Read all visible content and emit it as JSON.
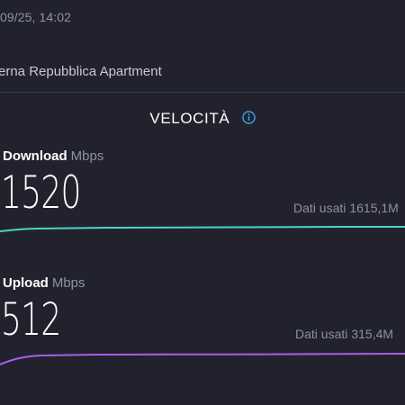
{
  "header": {
    "timestamp": "/09/25, 14:02",
    "server_name": "erna Repubblica Apartment"
  },
  "speed_section": {
    "title": "VELOCITÀ",
    "info_icon": "info-icon"
  },
  "download": {
    "label": "Download",
    "unit": "Mbps",
    "value": "1520",
    "data_used_label": "Dati usati",
    "data_used_value": "1615,1M",
    "line_color": "#4fd1c5"
  },
  "upload": {
    "label": "Upload",
    "unit": "Mbps",
    "value": "512",
    "data_used_label": "Dati usati",
    "data_used_value": "315,4M",
    "line_color": "#a660e6"
  }
}
